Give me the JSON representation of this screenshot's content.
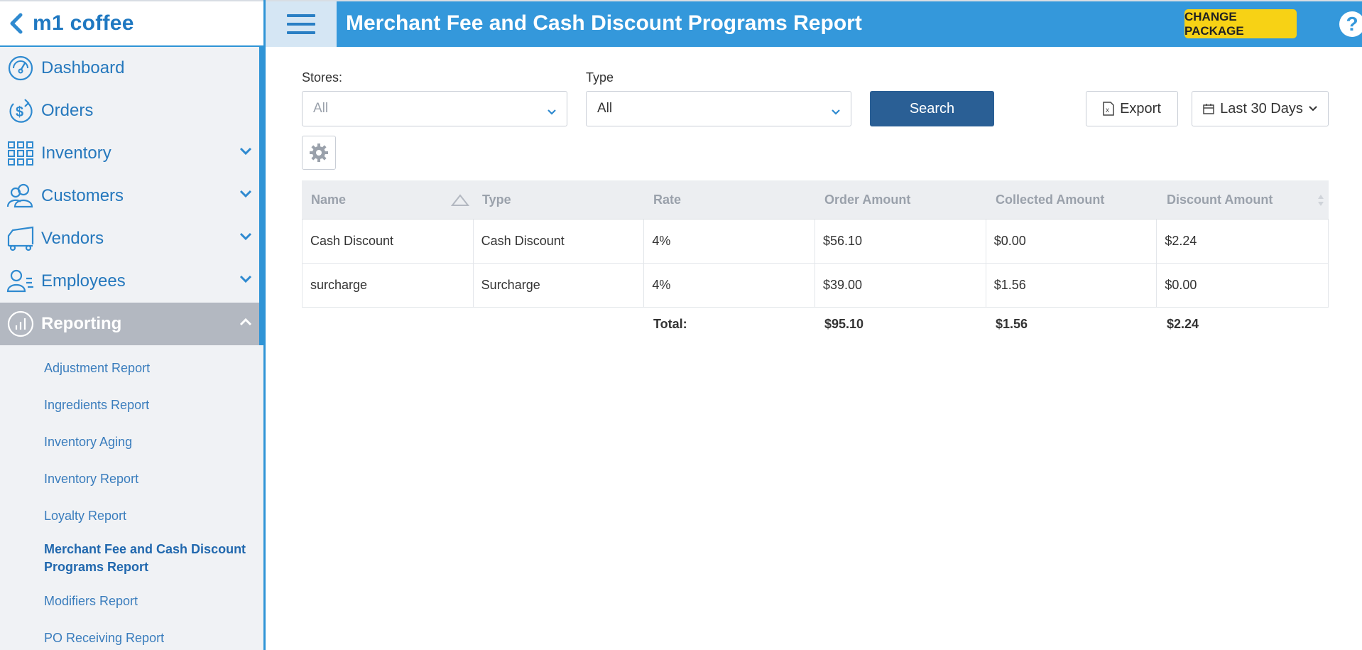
{
  "brand": {
    "name": "m1 coffee"
  },
  "nav": {
    "items": [
      {
        "label": "Dashboard",
        "icon": "dashboard-gauge-icon"
      },
      {
        "label": "Orders",
        "icon": "orders-dollar-icon"
      },
      {
        "label": "Inventory",
        "icon": "inventory-grid-icon"
      },
      {
        "label": "Customers",
        "icon": "customers-people-icon"
      },
      {
        "label": "Vendors",
        "icon": "vendors-truck-icon"
      },
      {
        "label": "Employees",
        "icon": "employees-icon"
      },
      {
        "label": "Reporting",
        "icon": "reporting-chart-icon"
      }
    ],
    "reporting_sub": [
      "Adjustment Report",
      "Ingredients Report",
      "Inventory Aging",
      "Inventory Report",
      "Loyalty Report",
      "Merchant Fee and Cash Discount Programs Report",
      "Modifiers Report",
      "PO Receiving Report"
    ]
  },
  "header": {
    "title": "Merchant Fee and Cash Discount Programs Report",
    "change_package": "CHANGE PACKAGE",
    "help": "?"
  },
  "filters": {
    "stores_label": "Stores:",
    "stores_value": "All",
    "type_label": "Type",
    "type_value": "All",
    "search": "Search",
    "export": "Export",
    "date_range": "Last 30 Days"
  },
  "table": {
    "headers": [
      "Name",
      "Type",
      "Rate",
      "Order Amount",
      "Collected Amount",
      "Discount Amount"
    ],
    "rows": [
      [
        "Cash Discount",
        "Cash Discount",
        "4%",
        "$56.10",
        "$0.00",
        "$2.24"
      ],
      [
        "surcharge",
        "Surcharge",
        "4%",
        "$39.00",
        "$1.56",
        "$0.00"
      ]
    ],
    "total": {
      "label": "Total:",
      "order_amount": "$95.10",
      "collected_amount": "$1.56",
      "discount_amount": "$2.24"
    }
  },
  "colors": {
    "accent": "#3498db",
    "button": "#2a5f95",
    "package": "#f7d215",
    "sidebar": "#f0f2f5"
  }
}
